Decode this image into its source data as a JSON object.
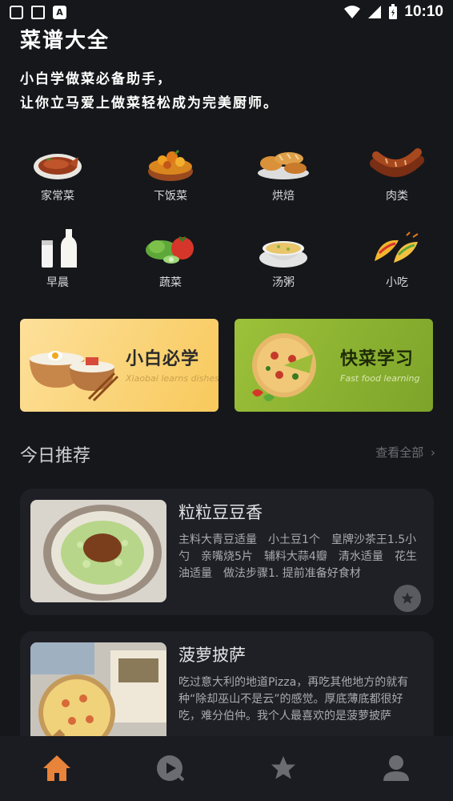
{
  "status_bar": {
    "time": "10:10",
    "notif_glyph": "A"
  },
  "header": {
    "title": "菜谱大全",
    "slogan_line1": "小白学做菜必备助手，",
    "slogan_line2": "让你立马爱上做菜轻松成为完美厨师。"
  },
  "categories": [
    {
      "label": "家常菜",
      "icon": "braised-fish-icon"
    },
    {
      "label": "下饭菜",
      "icon": "stir-fry-bowl-icon"
    },
    {
      "label": "烘焙",
      "icon": "bread-icon"
    },
    {
      "label": "肉类",
      "icon": "sausage-icon"
    },
    {
      "label": "早晨",
      "icon": "milk-icon"
    },
    {
      "label": "蔬菜",
      "icon": "vegetables-icon"
    },
    {
      "label": "汤粥",
      "icon": "soup-icon"
    },
    {
      "label": "小吃",
      "icon": "taco-icon"
    }
  ],
  "banners": [
    {
      "title": "小白必学",
      "subtitle": "Xiaobai learns dishes",
      "color": "#f8c95c"
    },
    {
      "title": "快菜学习",
      "subtitle": "Fast food learning",
      "color": "#8fb534"
    }
  ],
  "recommend": {
    "title": "今日推荐",
    "more_label": "查看全部",
    "items": [
      {
        "title": "粒粒豆豆香",
        "desc": "主料大青豆适量　小土豆1个　皇牌沙茶王1.5小勺　亲嘴烧5片　辅料大蒜4瓣　清水适量　花生油适量　做法步骤1. 提前准备好食材"
      },
      {
        "title": "菠萝披萨",
        "desc": "吃过意大利的地道Pizza，再吃其他地方的就有种“除却巫山不是云”的感觉。厚底薄底都很好吃，难分伯仲。我个人最喜欢的是菠萝披萨"
      }
    ]
  },
  "tab_bar": {
    "active_color": "#e8833a",
    "inactive_color": "#6b6c72",
    "tabs": [
      "home-icon",
      "play-icon",
      "star-icon",
      "person-icon"
    ]
  }
}
